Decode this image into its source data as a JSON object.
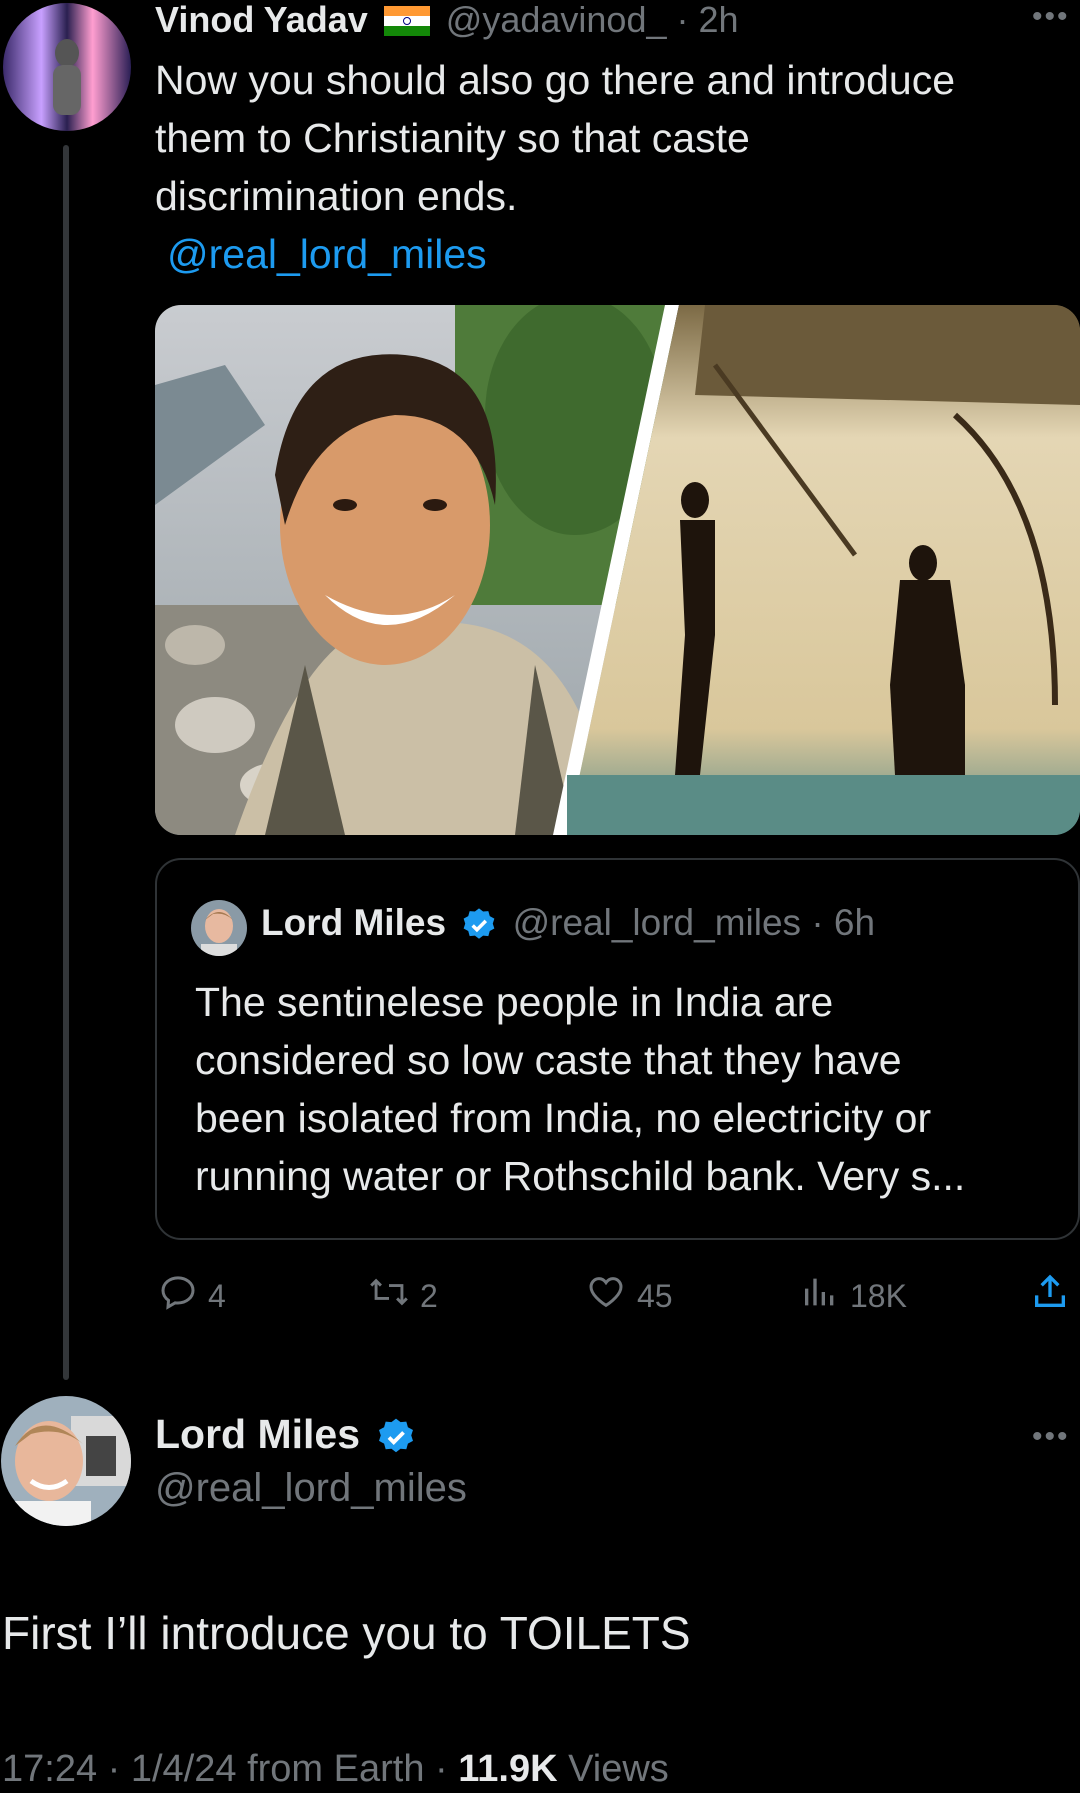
{
  "first_tweet": {
    "author_name": "Vinod Yadav",
    "flag": "🇮🇳",
    "handle": "@yadavinod_",
    "time": "· 2h",
    "text_lines": [
      "Now you should also go there and introduce",
      "them to Christianity so that caste",
      "discrimination ends."
    ],
    "mention": "@real_lord_miles",
    "more_icon": "more-dots-icon"
  },
  "quote": {
    "author_name": "Lord Miles",
    "handle": "@real_lord_miles",
    "time": "· 6h",
    "text_lines": [
      "The sentinelese people in India are",
      "considered so low caste that they have",
      "been isolated from India, no electricity or",
      "running water or Rothschild bank. Very s..."
    ]
  },
  "actions": {
    "replies": "4",
    "reposts": "2",
    "likes": "45",
    "views": "18K"
  },
  "reply": {
    "author_name": "Lord Miles",
    "handle": "@real_lord_miles",
    "text": "First I’ll introduce you to TOILETS",
    "meta_time": "17:24 · 1/4/24 from Earth · ",
    "views_count": "11.9K",
    "views_label": " Views"
  },
  "colors": {
    "accent": "#1d9bf0",
    "muted": "#71767b",
    "border": "#2f3336",
    "text": "#e7e9ea",
    "bg": "#000000"
  }
}
